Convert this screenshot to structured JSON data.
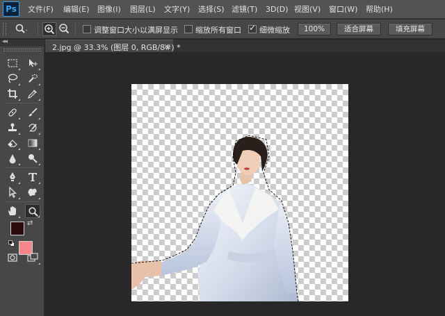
{
  "app": {
    "logo": "Ps"
  },
  "menubar": {
    "items": [
      "文件(F)",
      "编辑(E)",
      "图像(I)",
      "图层(L)",
      "文字(Y)",
      "选择(S)",
      "滤镜(T)",
      "3D(D)",
      "视图(V)",
      "窗口(W)",
      "帮助(H)"
    ]
  },
  "options": {
    "tool_icon": "zoom-icon",
    "zoom_in_icon": "zoom-in-icon",
    "zoom_out_icon": "zoom-out-icon",
    "resize_windows_label": "调整窗口大小以满屏显示",
    "resize_windows_checked": false,
    "zoom_all_windows_label": "缩放所有窗口",
    "zoom_all_windows_checked": false,
    "scrubby_zoom_label": "细微缩放",
    "scrubby_zoom_checked": true,
    "btn_100": "100%",
    "btn_fit": "适合屏幕",
    "btn_fill": "填充屏幕"
  },
  "toolbox": {
    "collapse_icon": "double-chevron-icon",
    "tools": [
      "rectangular-marquee-icon",
      "move-icon",
      "lasso-icon",
      "quick-selection-icon",
      "crop-icon",
      "eyedropper-icon",
      "spot-healing-icon",
      "brush-icon",
      "clone-stamp-icon",
      "history-brush-icon",
      "eraser-icon",
      "gradient-icon",
      "blur-icon",
      "dodge-icon",
      "pen-icon",
      "type-icon",
      "path-selection-icon",
      "custom-shape-icon",
      "hand-icon",
      "zoom-icon",
      "quick-mask-icon",
      "screen-mode-icon"
    ],
    "foreground_color": "#2a0c0e",
    "background_color": "#f4868c"
  },
  "document": {
    "tab_title": "2.jpg @ 33.3% (图层 0, RGB/8#) *",
    "close_icon": "close-icon"
  }
}
